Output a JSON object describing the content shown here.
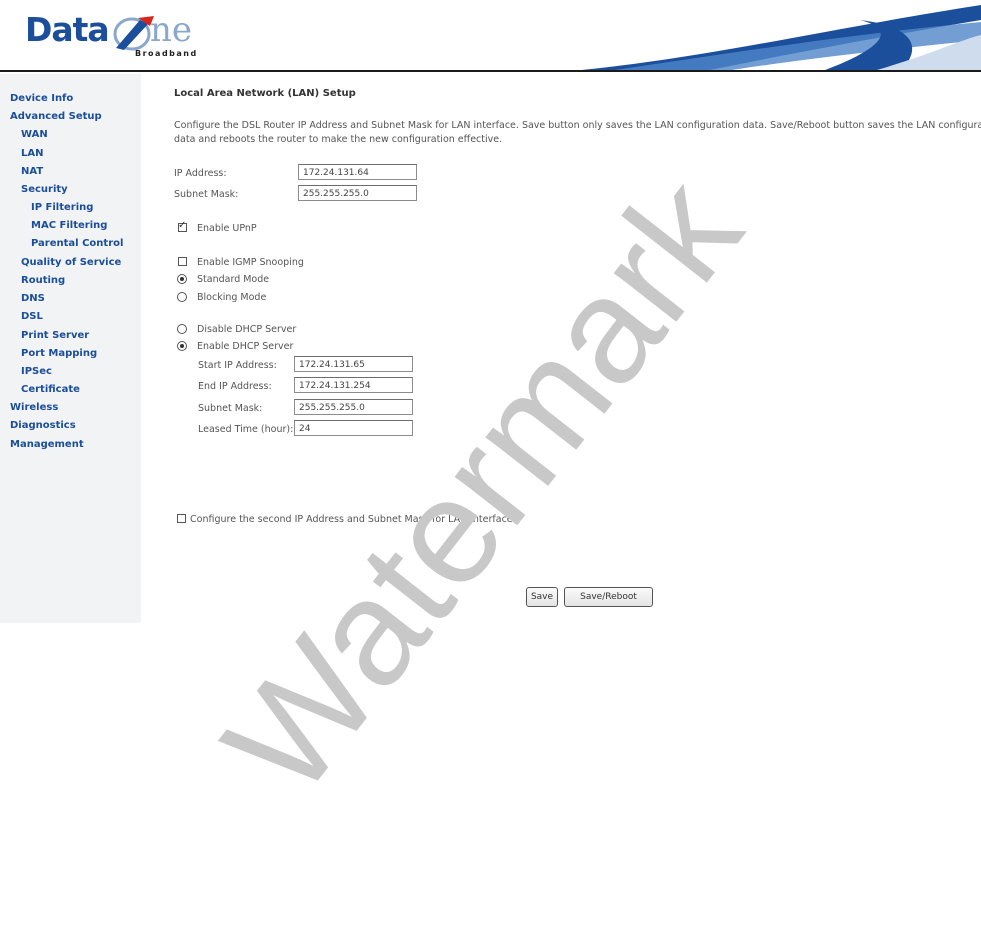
{
  "header": {
    "logo_data": "Data",
    "logo_ne": "ne",
    "logo_sub": "Broadband"
  },
  "sidebar": {
    "items": [
      {
        "label": "Device Info"
      },
      {
        "label": "Advanced Setup"
      },
      {
        "label": "WAN"
      },
      {
        "label": "LAN"
      },
      {
        "label": "NAT"
      },
      {
        "label": "Security"
      },
      {
        "label": "IP Filtering"
      },
      {
        "label": "MAC Filtering"
      },
      {
        "label": "Parental Control"
      },
      {
        "label": "Quality of Service"
      },
      {
        "label": "Routing"
      },
      {
        "label": "DNS"
      },
      {
        "label": "DSL"
      },
      {
        "label": "Print Server"
      },
      {
        "label": "Port Mapping"
      },
      {
        "label": "IPSec"
      },
      {
        "label": "Certificate"
      },
      {
        "label": "Wireless"
      },
      {
        "label": "Diagnostics"
      },
      {
        "label": "Management"
      }
    ]
  },
  "main": {
    "title": "Local Area Network (LAN) Setup",
    "description_line1": "Configure the DSL Router IP Address and Subnet Mask for LAN interface.  Save button only saves the LAN configuration data.  Save/Reboot button saves the LAN configuration",
    "description_line2": "data and reboots the router to make the new configuration effective.",
    "ip_address_label": "IP Address:",
    "ip_address_value": "172.24.131.64",
    "subnet_mask_label": "Subnet Mask:",
    "subnet_mask_value": "255.255.255.0",
    "upnp_label": "Enable UPnP",
    "upnp_checked": true,
    "igmp_label": "Enable IGMP Snooping",
    "igmp_checked": false,
    "standard_mode_label": "Standard Mode",
    "blocking_mode_label": "Blocking Mode",
    "igmp_mode_selected": "standard",
    "disable_dhcp_label": "Disable DHCP Server",
    "enable_dhcp_label": "Enable DHCP Server",
    "dhcp_selected": "enable",
    "start_ip_label": "Start IP Address:",
    "start_ip_value": "172.24.131.65",
    "end_ip_label": "End IP Address:",
    "end_ip_value": "172.24.131.254",
    "dhcp_subnet_label": "Subnet Mask:",
    "dhcp_subnet_value": "255.255.255.0",
    "leased_time_label": "Leased Time (hour):",
    "leased_time_value": "24",
    "second_ip_label": "Configure the second IP Address and Subnet Mask for LAN interface",
    "second_ip_checked": false,
    "save_label": "Save",
    "save_reboot_label": "Save/Reboot"
  },
  "watermark": "Watermark",
  "colors": {
    "nav_link": "#1a4d9a",
    "sidebar_bg": "#f2f3f5",
    "logo_blue": "#1b4f9c"
  }
}
